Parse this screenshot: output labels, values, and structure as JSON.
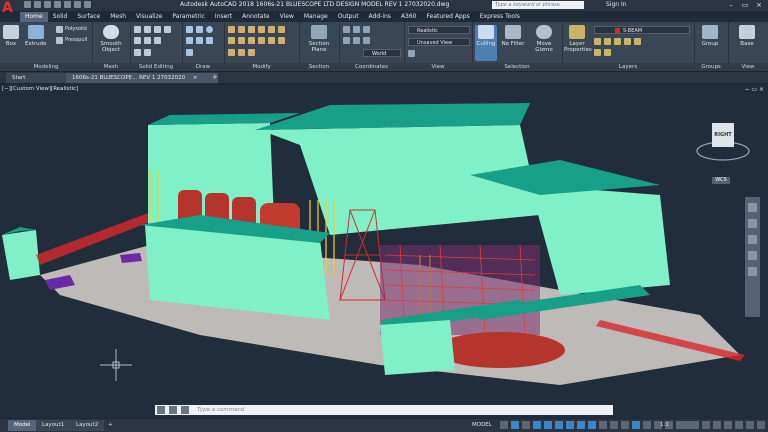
{
  "titlebar": {
    "app_logo": "A",
    "title": "Autodesk AutoCAD 2018   1606s-21 BLUESCOPE LTD DESIGN MODEL REV 1 27032020.dwg",
    "search_placeholder": "Type a keyword or phrase",
    "sign_in": "Sign In"
  },
  "menu_tabs": [
    "Home",
    "Solid",
    "Surface",
    "Mesh",
    "Visualize",
    "Parametric",
    "Insert",
    "Annotate",
    "View",
    "Manage",
    "Output",
    "Add-ins",
    "A360",
    "Featured Apps",
    "Express Tools"
  ],
  "ribbon": {
    "modeling": {
      "title": "Modeling",
      "box": "Box",
      "extrude": "Extrude",
      "polysolid": "Polysolid",
      "presspull": "Presspull"
    },
    "mesh": {
      "title": "Mesh",
      "smooth_object": "Smooth Object"
    },
    "solid_editing": {
      "title": "Solid Editing"
    },
    "draw": {
      "title": "Draw"
    },
    "modify": {
      "title": "Modify"
    },
    "section": {
      "title": "Section",
      "section_plane": "Section Plane"
    },
    "coordinates": {
      "title": "Coordinates",
      "world": "World"
    },
    "view": {
      "title": "View",
      "visual_style": "Realistic",
      "unsaved_view": "Unsaved View"
    },
    "selection": {
      "title": "Selection",
      "culling": "Culling",
      "no_filter": "No Filter",
      "move_gizmo": "Move Gizmo"
    },
    "layers": {
      "title": "Layers",
      "layer_properties": "Layer Properties",
      "current_layer": "S-BEAM"
    },
    "groups": {
      "title": "Groups",
      "group": "Group"
    },
    "view2": {
      "title": "View",
      "base": "Base"
    }
  },
  "file_tabs": [
    "Start",
    "1606s-21 BLUESCOPE... REV 1 27032020"
  ],
  "viewport": {
    "label": "[−][Custom View][Realistic]",
    "controls": "− ▭ ×",
    "viewcube_face": "RIGHT",
    "wcs": "WCS"
  },
  "command_line": {
    "placeholder": "Type a command"
  },
  "status": {
    "layout_tabs": [
      "Model",
      "Layout1",
      "Layout2",
      "+"
    ],
    "model_label": "MODEL",
    "scale": "1:1"
  },
  "colors": {
    "building_cyan": "#7ff0c8",
    "roof_teal": "#17a087",
    "silo_red": "#b5342c",
    "steel_yellow": "#f2d21b",
    "steel_red": "#d8282a",
    "purple": "#6a2aa8"
  }
}
